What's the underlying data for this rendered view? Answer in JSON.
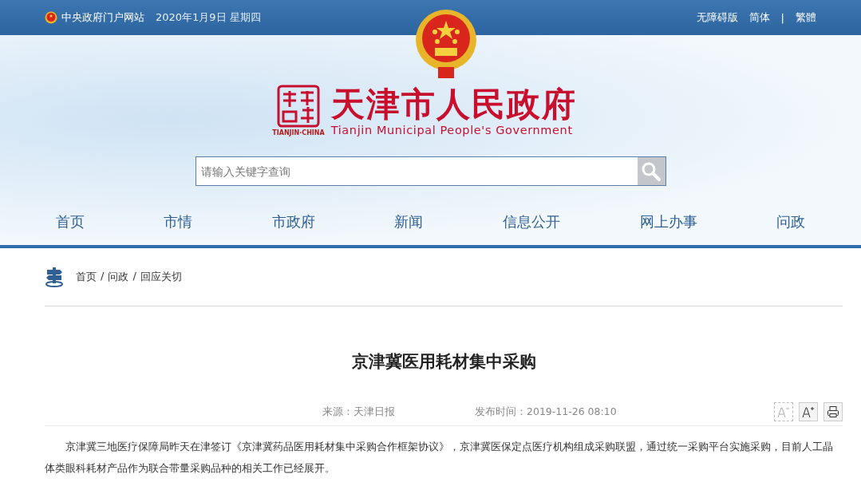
{
  "top_bar": {
    "site_link": "中央政府门户网站",
    "date": "2020年1月9日 星期四",
    "links": [
      {
        "label": "无障碍版",
        "separator_after": false
      },
      {
        "label": "简体",
        "separator_after": true
      },
      {
        "label": "繁體",
        "separator_after": false
      }
    ],
    "separator": "|"
  },
  "header": {
    "title": "天津市人民政府",
    "subtitle": "Tianjin Municipal People's Government",
    "seal_caption": "TIANJIN·CHINA"
  },
  "search": {
    "placeholder": "请输入关键字查询"
  },
  "nav": [
    {
      "label": "首页"
    },
    {
      "label": "市情"
    },
    {
      "label": "市政府"
    },
    {
      "label": "新闻"
    },
    {
      "label": "信息公开"
    },
    {
      "label": "网上办事"
    },
    {
      "label": "问政"
    }
  ],
  "breadcrumb": {
    "items": [
      "首页",
      "问政",
      "回应关切"
    ],
    "separator": "/"
  },
  "article": {
    "title": "京津冀医用耗材集中采购",
    "source": "来源：天津日报",
    "published": "发布时间：2019-11-26 08:10",
    "tools": [
      {
        "kind": "font-decrease",
        "disabled": true
      },
      {
        "kind": "font-increase",
        "disabled": false
      },
      {
        "kind": "print",
        "disabled": false
      }
    ],
    "paragraphs": [
      "京津冀三地医疗保障局昨天在津签订《京津冀药品医用耗材集中采购合作框架协议》，京津冀医保定点医疗机构组成采购联盟，通过统一采购平台实施采购，目前人工晶体类眼科耗材产品作为联合带量采购品种的相关工作已经展开。"
    ]
  }
}
